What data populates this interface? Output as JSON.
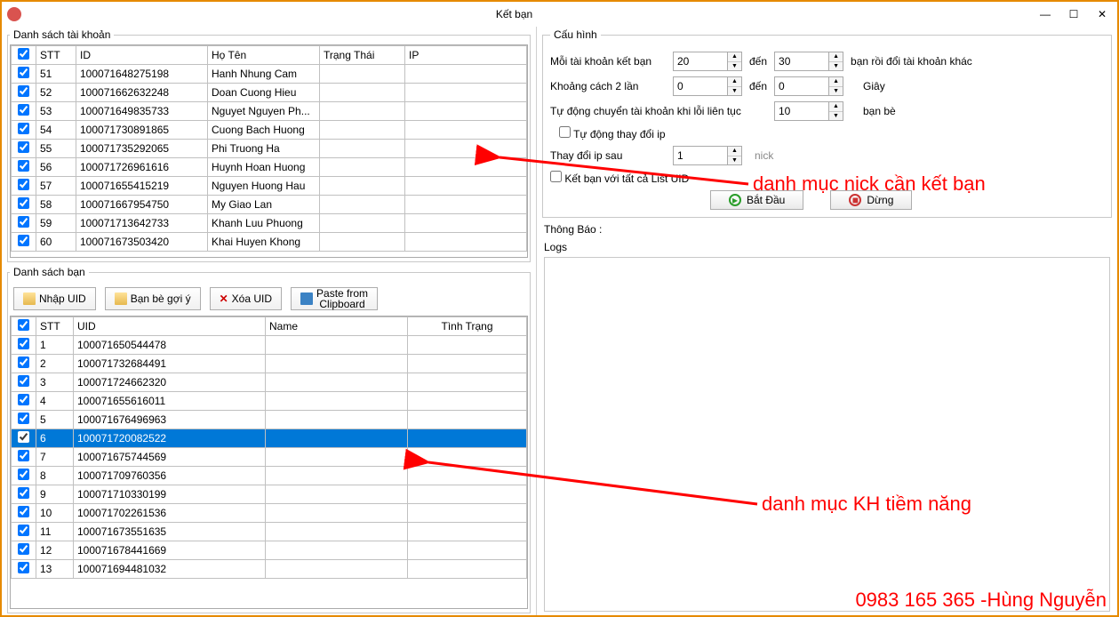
{
  "window": {
    "title": "Kết bạn",
    "min": "—",
    "max": "☐",
    "close": "✕"
  },
  "accounts": {
    "legend": "Danh sách tài khoản",
    "headers": [
      "STT",
      "ID",
      "Họ Tên",
      "Trạng Thái",
      "IP"
    ],
    "rows": [
      {
        "stt": "51",
        "id": "100071648275198",
        "name": "Hanh Nhung Cam"
      },
      {
        "stt": "52",
        "id": "100071662632248",
        "name": "Doan Cuong Hieu"
      },
      {
        "stt": "53",
        "id": "100071649835733",
        "name": "Nguyet Nguyen Ph..."
      },
      {
        "stt": "54",
        "id": "100071730891865",
        "name": "Cuong Bach Huong"
      },
      {
        "stt": "55",
        "id": "100071735292065",
        "name": "Phi Truong Ha"
      },
      {
        "stt": "56",
        "id": "100071726961616",
        "name": "Huynh Hoan Huong"
      },
      {
        "stt": "57",
        "id": "100071655415219",
        "name": "Nguyen Huong Hau"
      },
      {
        "stt": "58",
        "id": "100071667954750",
        "name": "My Giao Lan"
      },
      {
        "stt": "59",
        "id": "100071713642733",
        "name": "Khanh Luu Phuong"
      },
      {
        "stt": "60",
        "id": "100071673503420",
        "name": "Khai Huyen Khong"
      }
    ]
  },
  "friends": {
    "legend": "Danh sách bạn",
    "toolbar": {
      "import": "Nhập UID",
      "suggest": "Bạn bè gợi ý",
      "delete": "Xóa UID",
      "paste": "Paste from\nClipboard"
    },
    "headers": [
      "STT",
      "UID",
      "Name",
      "Tình Trạng"
    ],
    "selected": "6",
    "rows": [
      {
        "stt": "1",
        "uid": "100071650544478"
      },
      {
        "stt": "2",
        "uid": "100071732684491"
      },
      {
        "stt": "3",
        "uid": "100071724662320"
      },
      {
        "stt": "4",
        "uid": "100071655616011"
      },
      {
        "stt": "5",
        "uid": "100071676496963"
      },
      {
        "stt": "6",
        "uid": "100071720082522"
      },
      {
        "stt": "7",
        "uid": "100071675744569"
      },
      {
        "stt": "8",
        "uid": "100071709760356"
      },
      {
        "stt": "9",
        "uid": "100071710330199"
      },
      {
        "stt": "10",
        "uid": "100071702261536"
      },
      {
        "stt": "11",
        "uid": "100071673551635"
      },
      {
        "stt": "12",
        "uid": "100071678441669"
      },
      {
        "stt": "13",
        "uid": "100071694481032"
      }
    ]
  },
  "config": {
    "legend": "Cấu hình",
    "row1": {
      "l1": "Mỗi tài khoản kết bạn",
      "v1": "20",
      "mid": "đến",
      "v2": "30",
      "l2": "bạn rồi đổi tài khoản khác"
    },
    "row2": {
      "l1": "Khoảng cách 2 lần",
      "v1": "0",
      "mid": "đến",
      "v2": "0",
      "unit": "Giây"
    },
    "row3": {
      "l1": "Tự động chuyển tài khoản khi lỗi liên tục",
      "v": "10",
      "unit": "bạn bè"
    },
    "chk_ip": "Tự động thay đổi ip",
    "row4": {
      "l1": "Thay đổi ip sau",
      "v": "1",
      "unit": "nick"
    },
    "chk_all": "Kết bạn với tất cả List UID",
    "start": "Bắt Đầu",
    "stop": "Dừng"
  },
  "msg": "Thông Báo :",
  "logs": "Logs",
  "annotations": {
    "a1": "danh mục nick cần kết bạn",
    "a2": "danh mục KH tiềm năng"
  },
  "contact": "0983 165 365 -Hùng Nguyễn"
}
